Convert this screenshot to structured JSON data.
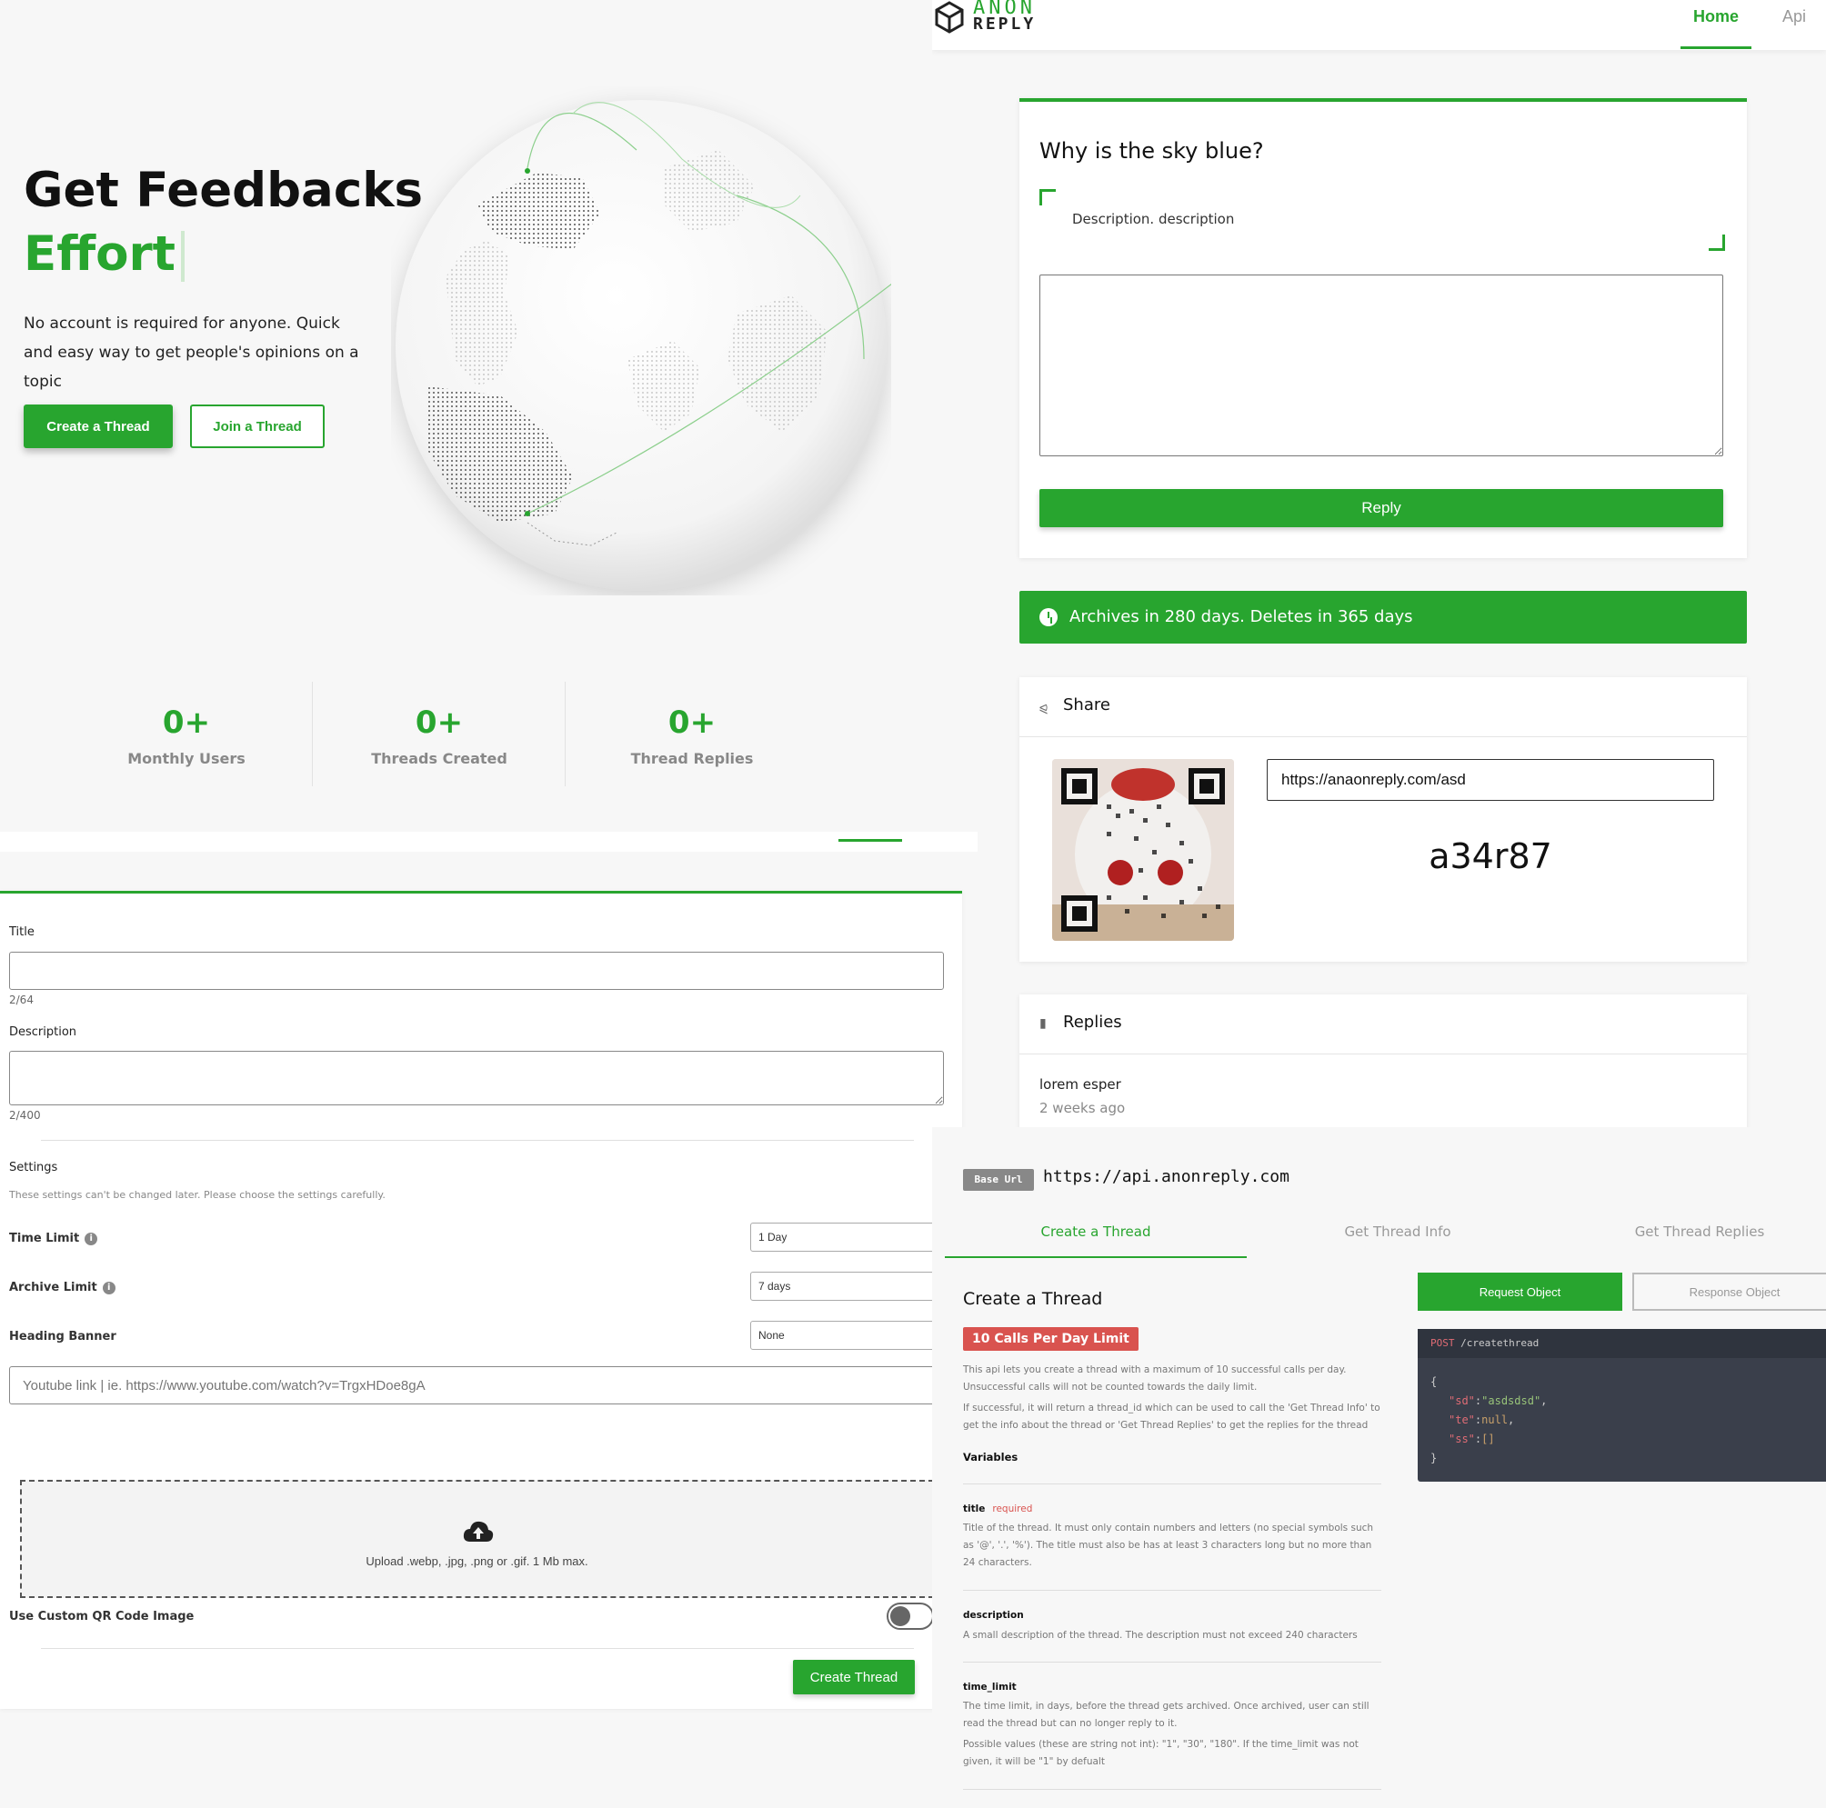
{
  "landing": {
    "headline": "Get Feedbacks",
    "rotating_word": "Effort",
    "subtitle": "No account is required for anyone. Quick and easy way to get people's opinions on a topic",
    "create_label": "Create a Thread",
    "join_label": "Join a Thread",
    "stats": [
      {
        "value": "0+",
        "label": "Monthly Users"
      },
      {
        "value": "0+",
        "label": "Threads Created"
      },
      {
        "value": "0+",
        "label": "Thread Replies"
      }
    ]
  },
  "thread": {
    "brand_top": "ANON",
    "brand_bottom": "REPLY",
    "nav": [
      "Home",
      "Api"
    ],
    "question": "Why is the sky blue?",
    "description": "Description. description",
    "reply_label": "Reply",
    "archive_notice": "Archives in 280 days. Deletes in 365 days",
    "share_title": "Share",
    "share_url": "https://anaonreply.com/asd",
    "share_code": "a34r87",
    "replies_title": "Replies",
    "replies": [
      {
        "text": "lorem esper",
        "time": "2 weeks ago"
      }
    ]
  },
  "form": {
    "title_label": "Title",
    "title_count": "2/64",
    "description_label": "Description",
    "description_count": "2/400",
    "settings_label": "Settings",
    "settings_note": "These settings can't be changed later. Please choose the settings carefully.",
    "time_limit_label": "Time Limit",
    "time_limit_value": "1 Day",
    "archive_limit_label": "Archive Limit",
    "archive_limit_value": "7 days",
    "heading_banner_label": "Heading Banner",
    "heading_banner_value": "None",
    "youtube_placeholder": "Youtube link | ie. https://www.youtube.com/watch?v=TrgxHDoe8gA",
    "upload_text": "Upload .webp, .jpg, .png or .gif. 1 Mb max.",
    "custom_qr_label": "Use Custom QR Code Image",
    "submit_label": "Create Thread"
  },
  "api": {
    "base_badge": "Base Url",
    "base_url": "https://api.anonreply.com",
    "tabs": [
      "Create a Thread",
      "Get Thread Info",
      "Get Thread Replies"
    ],
    "heading": "Create a Thread",
    "limit_badge": "10 Calls Per Day Limit",
    "intro_1": "This api lets you create a thread with a maximum of 10 successful calls per day. Unsuccessful calls will not be counted towards the daily limit.",
    "intro_2": "If successful, it will return a thread_id which can be used to call the 'Get Thread Info' to get the info about the thread or 'Get Thread Replies' to get the replies for the thread",
    "variables_label": "Variables",
    "vars": [
      {
        "name": "title",
        "flag": "required",
        "desc": "Title of the thread. It must only contain numbers and letters (no special symbols such as '@', '.', '%'). The title must also be has at least 3 characters long but no more than 24 characters."
      },
      {
        "name": "description",
        "flag": "",
        "desc": "A small description of the thread. The description must not exceed 240 characters"
      },
      {
        "name": "time_limit",
        "flag": "",
        "desc": "The time limit, in days, before the thread gets archived. Once archived, user can still read the thread but can no longer reply to it.",
        "desc2": "Possible values (these are string not int): \"1\", \"30\", \"180\". If the time_limit was not given, it will be \"1\" by defualt"
      }
    ],
    "request_label": "Request Object",
    "response_label": "Response Object",
    "code_method": "POST",
    "code_path": "/createthread",
    "code_lines": [
      {
        "key": "\"sd\"",
        "value": "\"asdsdsd\"",
        "kind": "s"
      },
      {
        "key": "\"te\"",
        "value": "null",
        "kind": "n"
      },
      {
        "key": "\"ss\"",
        "value": "[]",
        "kind": "n"
      }
    ]
  },
  "colors": {
    "accent": "#28a52f",
    "danger": "#d9534f",
    "code_bg": "#3a3f4b"
  }
}
